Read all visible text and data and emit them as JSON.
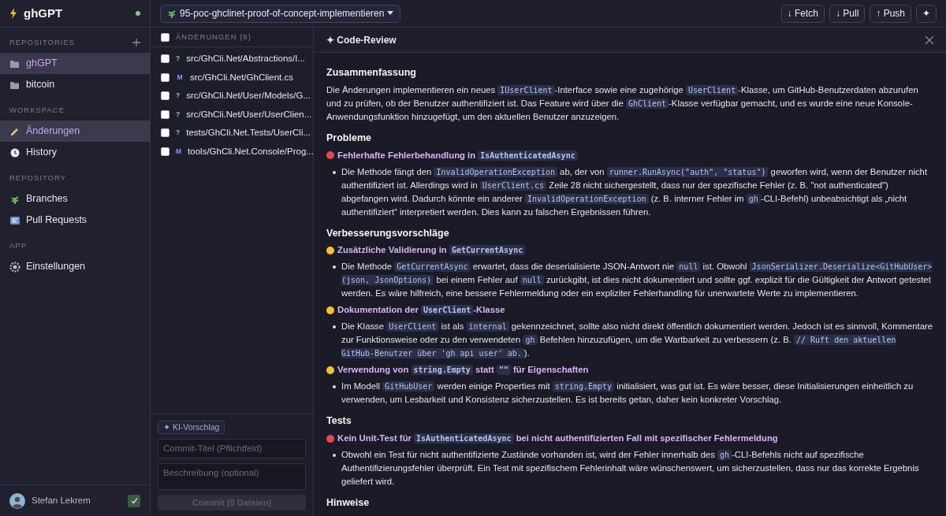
{
  "app": {
    "title": "ghGPT",
    "online": true
  },
  "sidebar": {
    "sections": [
      {
        "label": "REPOSITORIES",
        "add_button": true,
        "items": [
          {
            "label": "ghGPT",
            "selected": true
          },
          {
            "label": "bitcoin",
            "selected": false
          }
        ]
      },
      {
        "label": "WORKSPACE",
        "items": [
          {
            "label": "Änderungen",
            "selected": true
          },
          {
            "label": "History",
            "selected": false
          }
        ]
      },
      {
        "label": "REPOSITORY",
        "items": [
          {
            "label": "Branches",
            "selected": false
          },
          {
            "label": "Pull Requests",
            "selected": false
          }
        ]
      },
      {
        "label": "APP",
        "items": [
          {
            "label": "Einstellungen",
            "selected": false
          }
        ]
      }
    ]
  },
  "user": {
    "name": "Stefan Lekrem"
  },
  "toolbar": {
    "branch": "95-poc-ghclinet-proof-of-concept-implementieren",
    "buttons": [
      {
        "label": "↓ Fetch"
      },
      {
        "label": "↓ Pull"
      },
      {
        "label": "↑ Push"
      },
      {
        "label": "✦"
      }
    ]
  },
  "changes": {
    "header": "ÄNDERUNGEN (6)",
    "all_checked": false,
    "files": [
      {
        "kind": "untracked",
        "status": "?",
        "path": "src/GhCli.Net/Abstractions/I...",
        "checked": false
      },
      {
        "kind": "modified",
        "status": "M",
        "path": "src/GhCli.Net/GhClient.cs",
        "checked": false
      },
      {
        "kind": "untracked",
        "status": "?",
        "path": "src/GhCli.Net/User/Models/G...",
        "checked": false
      },
      {
        "kind": "untracked",
        "status": "?",
        "path": "src/GhCli.Net/User/UserClien...",
        "checked": false
      },
      {
        "kind": "untracked",
        "status": "?",
        "path": "tests/GhCli.Net.Tests/UserCli...",
        "checked": false
      },
      {
        "kind": "modified",
        "status": "M",
        "path": "tools/GhCli.Net.Console/Prog...",
        "checked": false
      }
    ]
  },
  "commit": {
    "ai_button": "✦ KI-Vorschlag",
    "title_placeholder": "Commit-Titel (Pflichtfeld)",
    "description_placeholder": "Beschreibung (optional)",
    "submit": "Commit (0 Dateien)",
    "disabled": true
  },
  "review": {
    "title": "✦ Code-Review",
    "sections": [
      {
        "heading": "Zusammenfassung",
        "paragraphs": [
          [
            {
              "text": "Die Änderungen implementieren ein neues "
            },
            {
              "code": "IUserClient"
            },
            {
              "text": "-Interface sowie eine zugehörige "
            },
            {
              "code": "UserClient"
            },
            {
              "text": "-Klasse, um GitHub-Benutzerdaten abzurufen und zu prüfen, ob der Benutzer authentifiziert ist. Das Feature wird über die "
            },
            {
              "code": "GhClient"
            },
            {
              "text": "-Klasse verfügbar gemacht, und es wurde eine neue Konsole-Anwendungsfunktion hinzugefügt, um den aktuellen Benutzer anzuzeigen."
            }
          ]
        ]
      },
      {
        "heading": "Probleme",
        "findings": [
          {
            "color": "#e5484d",
            "title": [
              {
                "text": "Fehlerhafte Fehlerbehandlung in "
              },
              {
                "code": "IsAuthenticatedAsync"
              }
            ],
            "bullets": [
              [
                {
                  "text": "Die Methode fängt den "
                },
                {
                  "code": "InvalidOperationException"
                },
                {
                  "text": " ab, der von "
                },
                {
                  "code": "runner.RunAsync(\"auth\", \"status\")"
                },
                {
                  "text": " geworfen wird, wenn der Benutzer nicht authentifiziert ist. Allerdings wird in "
                },
                {
                  "code": "UserClient.cs"
                },
                {
                  "text": " Zeile 28 nicht sichergestellt, dass nur der spezifische Fehler (z. B. \"not authenticated\") abgefangen wird. Dadurch könnte ein anderer "
                },
                {
                  "code": "InvalidOperationException"
                },
                {
                  "text": " (z. B. interner Fehler im "
                },
                {
                  "code": "gh"
                },
                {
                  "text": "-CLI-Befehl) unbeabsichtigt als „nicht authentifiziert“ interpretiert werden. Dies kann zu falschen Ergebnissen führen."
                }
              ]
            ]
          }
        ]
      },
      {
        "heading": "Verbesserungsvorschläge",
        "findings": [
          {
            "color": "#f2c233",
            "title": [
              {
                "text": "Zusätzliche Validierung in "
              },
              {
                "code": "GetCurrentAsync"
              }
            ],
            "bullets": [
              [
                {
                  "text": "Die Methode "
                },
                {
                  "code": "GetCurrentAsync"
                },
                {
                  "text": " erwartet, dass die deserialisierte JSON-Antwort nie "
                },
                {
                  "code": "null"
                },
                {
                  "text": " ist. Obwohl "
                },
                {
                  "code": "JsonSerializer.Deserialize<GitHubUser>(json, JsonOptions)"
                },
                {
                  "text": " bei einem Fehler auf "
                },
                {
                  "code": "null"
                },
                {
                  "text": " zurückgibt, ist dies nicht dokumentiert und sollte ggf. explizit für die Gültigkeit der Antwort getestet werden. Es wäre hilfreich, eine bessere Fehlermeldung oder ein expliziter Fehlerhandling für unerwartete Werte zu implementieren."
                }
              ]
            ]
          },
          {
            "color": "#f2c233",
            "title": [
              {
                "text": "Dokumentation der "
              },
              {
                "code": "UserClient"
              },
              {
                "text": "-Klasse"
              }
            ],
            "bullets": [
              [
                {
                  "text": "Die Klasse "
                },
                {
                  "code": "UserClient"
                },
                {
                  "text": " ist als "
                },
                {
                  "code": "internal"
                },
                {
                  "text": " gekennzeichnet, sollte also nicht direkt öffentlich dokumentiert werden. Jedoch ist es sinnvoll, Kommentare zur Funktionsweise oder zu den verwendeten "
                },
                {
                  "code": "gh"
                },
                {
                  "text": " Befehlen hinzuzufügen, um die Wartbarkeit zu verbessern (z. B. "
                },
                {
                  "code": "// Ruft den aktuellen GitHub-Benutzer über 'gh api user' ab."
                },
                {
                  "text": ")."
                }
              ]
            ]
          },
          {
            "color": "#f2c233",
            "title": [
              {
                "text": "Verwendung von "
              },
              {
                "code": "string.Empty"
              },
              {
                "text": " statt "
              },
              {
                "code": "\"\""
              },
              {
                "text": " für Eigenschaften"
              }
            ],
            "bullets": [
              [
                {
                  "text": "Im Modell "
                },
                {
                  "code": "GitHubUser"
                },
                {
                  "text": " werden einige Properties mit "
                },
                {
                  "code": "string.Empty"
                },
                {
                  "text": " initialisiert, was gut ist. Es wäre besser, diese Initialisierungen einheitlich zu verwenden, um Lesbarkeit und Konsistenz sicherzustellen. Es ist bereits getan, daher kein konkreter Vorschlag."
                }
              ]
            ]
          }
        ]
      },
      {
        "heading": "Tests",
        "findings": [
          {
            "color": "#e5484d",
            "title": [
              {
                "text": "Kein Unit-Test für "
              },
              {
                "code": "IsAuthenticatedAsync"
              },
              {
                "text": " bei nicht authentifizierten Fall mit spezifischer Fehlermeldung"
              }
            ],
            "bullets": [
              [
                {
                  "text": "Obwohl ein Test für nicht authentifizierte Zustände vorhanden ist, wird der Fehler innerhalb des "
                },
                {
                  "code": "gh"
                },
                {
                  "text": "-CLI-Befehls nicht auf spezifische Authentifizierungsfehler überprüft. Ein Test mit spezifischem Fehlerinhalt wäre wünschenswert, um sicherzustellen, dass nur das korrekte Ergebnis geliefert wird."
                }
              ]
            ]
          }
        ]
      },
      {
        "heading": "Hinweise"
      }
    ]
  }
}
